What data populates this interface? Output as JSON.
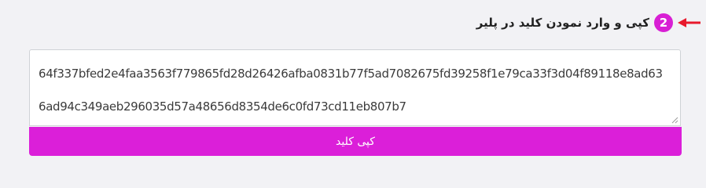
{
  "step": {
    "number": "2",
    "title": "کپی و وارد نمودن کلید در پلیر"
  },
  "key_field": {
    "value": "64f337bfed2e4faa3563f779865fd28d26426afba0831b77f5ad7082675fd39258f1e79ca33f3d04f89118e8ad636ad94c349aeb296035d57a48656d8354de6c0fd73cd11eb807b7"
  },
  "copy_button": {
    "label": "کپی کلید"
  },
  "colors": {
    "accent": "#db1fd9",
    "arrow": "#e8192c",
    "background": "#f2f2f5"
  },
  "icons": {
    "pointer": "arrow-left-icon",
    "resize": "resize-handle-icon"
  }
}
